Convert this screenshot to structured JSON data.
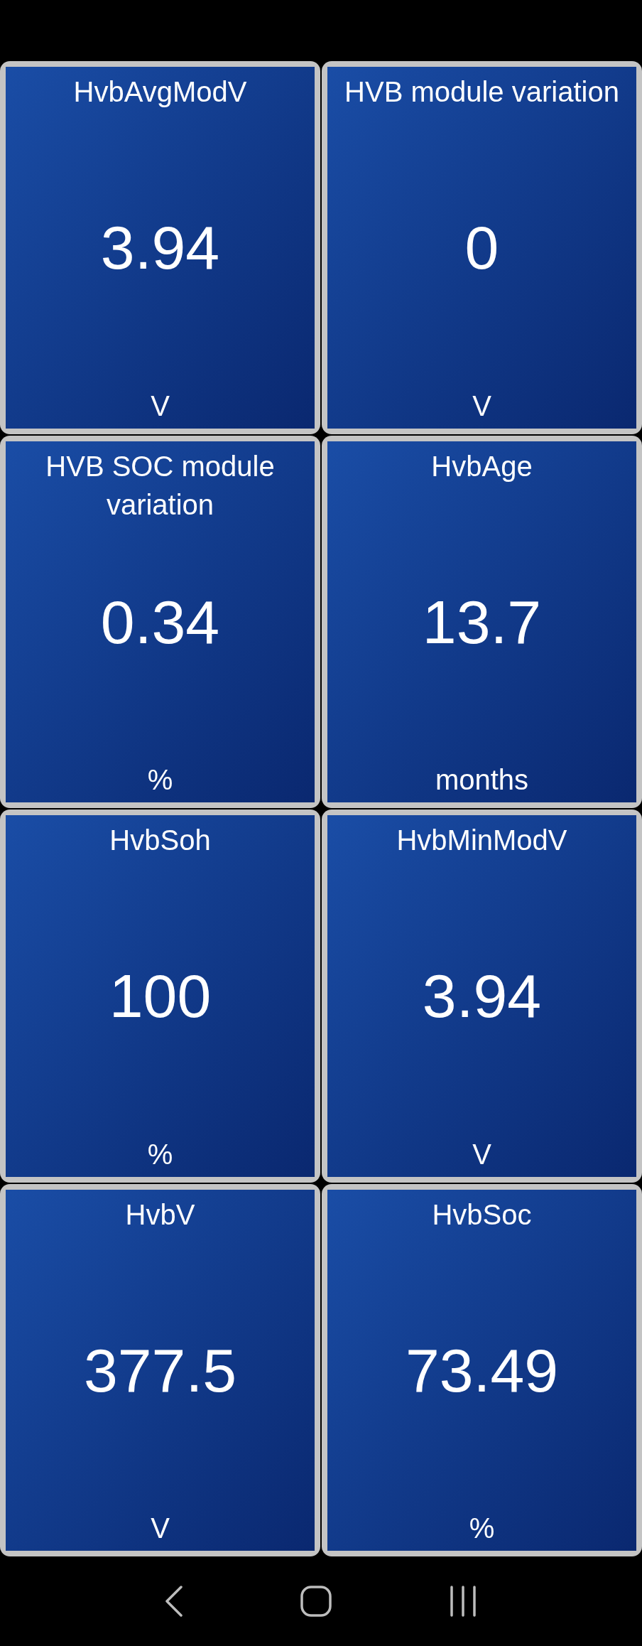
{
  "gauges": [
    {
      "title": "HvbAvgModV",
      "value": "3.94",
      "unit": "V"
    },
    {
      "title": "HVB module variation",
      "value": "0",
      "unit": "V"
    },
    {
      "title": "HVB SOC module variation",
      "value": "0.34",
      "unit": "%"
    },
    {
      "title": "HvbAge",
      "value": "13.7",
      "unit": "months"
    },
    {
      "title": "HvbSoh",
      "value": "100",
      "unit": "%"
    },
    {
      "title": "HvbMinModV",
      "value": "3.94",
      "unit": "V"
    },
    {
      "title": "HvbV",
      "value": "377.5",
      "unit": "V"
    },
    {
      "title": "HvbSoc",
      "value": "73.49",
      "unit": "%"
    }
  ]
}
